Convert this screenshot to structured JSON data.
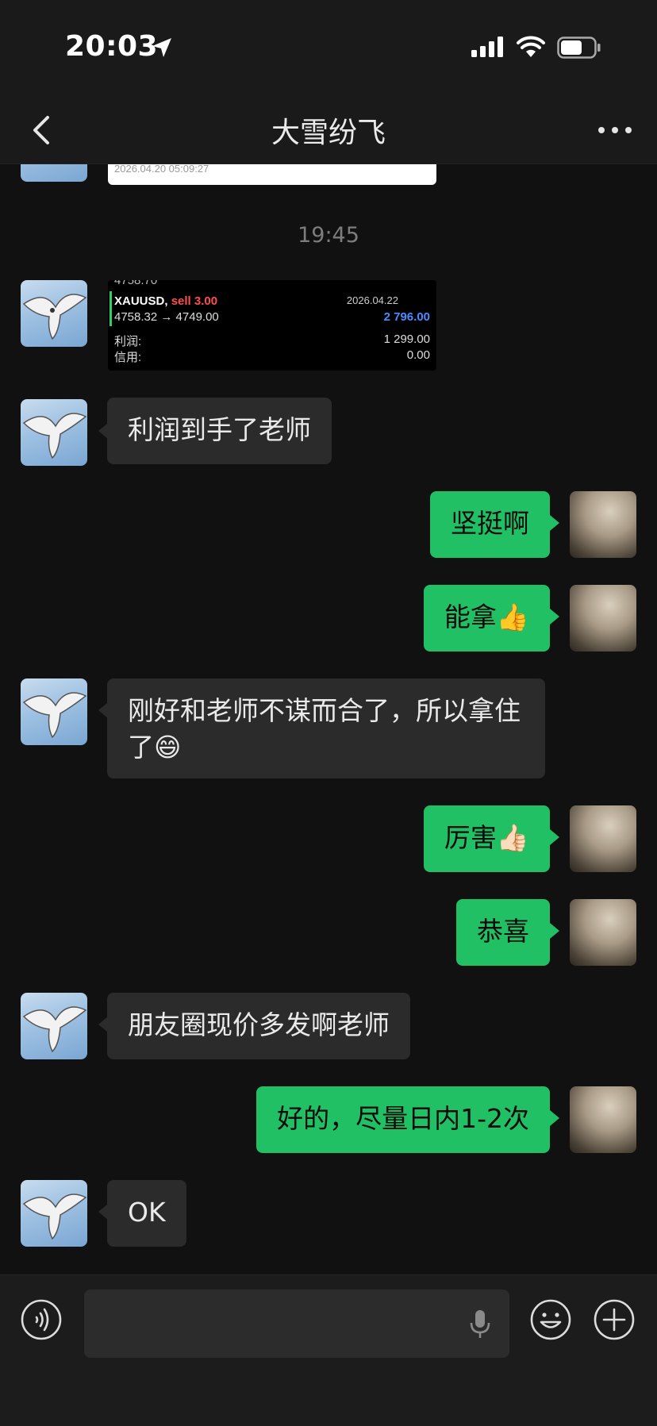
{
  "status_bar": {
    "time": "20:03"
  },
  "nav": {
    "title": "大雪纷飞"
  },
  "chat": {
    "timestamp": "19:45",
    "top_card": {
      "date": "2026.04.20 05:09:27"
    },
    "trade_card": {
      "partial_top": "4758.70",
      "symbol": "XAUUSD,",
      "action": "sell 3.00",
      "date": "2026.04.22",
      "price_move": "4758.32 → 4749.00",
      "amount": "2 796.00",
      "profit_label": "利润:",
      "profit_value": "1 299.00",
      "credit_label": "信用:",
      "credit_value": "0.00"
    },
    "messages": [
      {
        "side": "in",
        "text": "利润到手了老师"
      },
      {
        "side": "out",
        "text": "坚挺啊"
      },
      {
        "side": "out",
        "text": "能拿👍"
      },
      {
        "side": "in",
        "text": "刚好和老师不谋而合了，所以拿住了😄"
      },
      {
        "side": "out",
        "text": "厉害👍🏻"
      },
      {
        "side": "out",
        "text": "恭喜"
      },
      {
        "side": "in",
        "text": "朋友圈现价多发啊老师"
      },
      {
        "side": "out",
        "text": "好的，尽量日内1-2次"
      },
      {
        "side": "in",
        "text": "OK"
      }
    ]
  },
  "input": {
    "value": ""
  },
  "colors": {
    "outgoing_bubble": "#21c064",
    "incoming_bubble": "#2b2b2b",
    "background": "#111111"
  }
}
